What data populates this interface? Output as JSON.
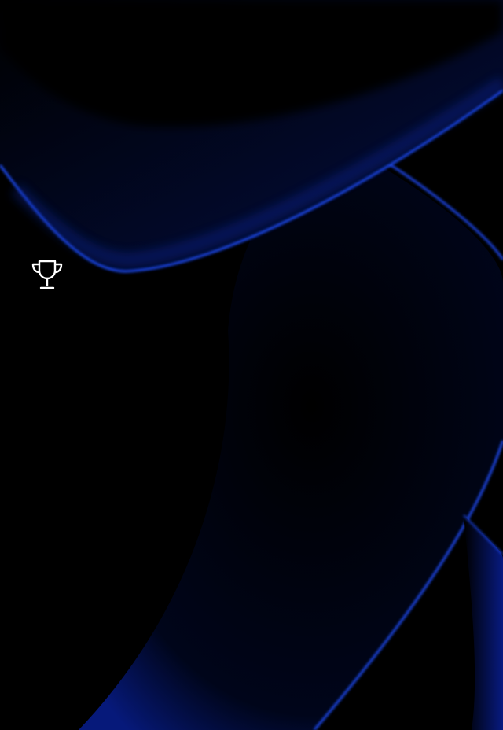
{
  "screen": {
    "background_color": "#000000",
    "accent_color": "#1a3fd6",
    "wallpaper": "dark-blue-abstract-waves"
  },
  "widgets": [
    {
      "icon": "trophy-icon",
      "color": "#ffffff"
    }
  ]
}
